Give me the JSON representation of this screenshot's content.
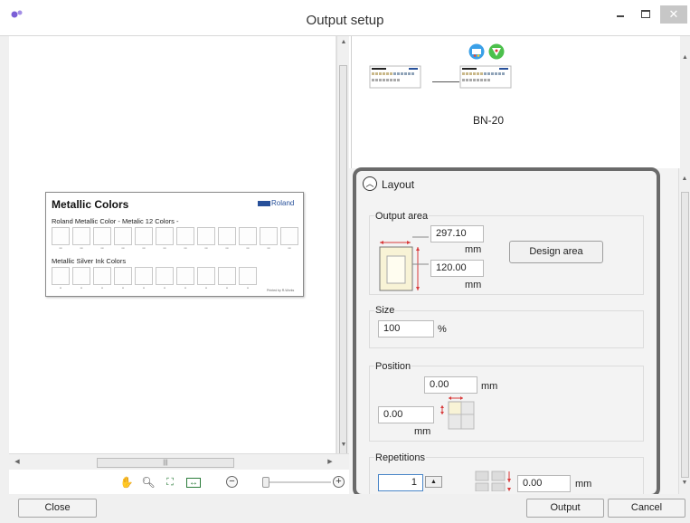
{
  "window": {
    "title": "Output setup"
  },
  "document": {
    "title": "Metallic Colors",
    "brand": "Roland",
    "section1": "Roland Metallic Color  - Metalic 12 Colors -",
    "section2": "Metallic Silver Ink Colors",
    "footer": "Printed by R-Works"
  },
  "printer": {
    "model": "BN-20"
  },
  "layout": {
    "header": "Layout",
    "output_area": {
      "label": "Output area",
      "width": "297.10",
      "width_unit": "mm",
      "height": "120.00",
      "height_unit": "mm",
      "design_area_button": "Design area"
    },
    "size": {
      "label": "Size",
      "value": "100",
      "unit": "%"
    },
    "position": {
      "label": "Position",
      "x": "0.00",
      "x_unit": "mm",
      "y": "0.00",
      "y_unit": "mm"
    },
    "repetitions": {
      "label": "Repetitions",
      "count": "1",
      "spacing": "0.00",
      "spacing_unit": "mm"
    }
  },
  "footer": {
    "close": "Close",
    "output": "Output",
    "cancel": "Cancel"
  },
  "colors": {
    "highlight_border": "#6a6a6a",
    "roland_blue": "#27509a",
    "dimension_red": "#d83a3a"
  }
}
